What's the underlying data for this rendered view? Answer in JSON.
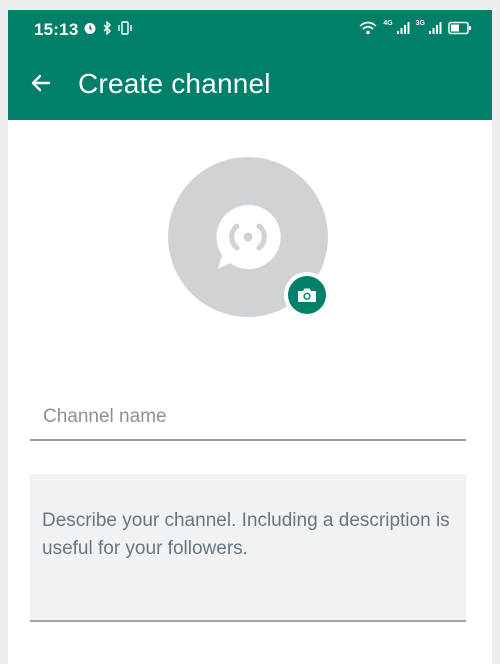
{
  "status_bar": {
    "time": "15:13",
    "network_label_1": "4G",
    "network_label_2": "3G"
  },
  "header": {
    "title": "Create channel",
    "back_icon": "arrow-left-icon",
    "background": "#008069"
  },
  "avatar": {
    "icon": "channel-broadcast-icon",
    "background": "#cfd3d6",
    "camera_icon": "camera-icon",
    "camera_color": "#008069"
  },
  "form": {
    "name_placeholder": "Channel name",
    "name_value": "",
    "description_placeholder": "Describe your channel. Including a description is useful for your followers.",
    "description_value": ""
  }
}
